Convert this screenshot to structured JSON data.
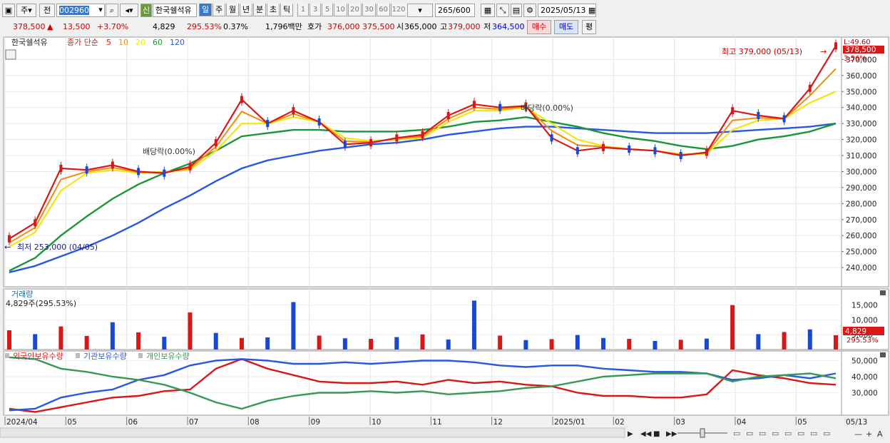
{
  "toolbar": {
    "market": "주",
    "prev": "전",
    "code": "002960",
    "name": "한국쉘석유",
    "new_badge": "신",
    "periods": [
      "일",
      "주",
      "월",
      "년",
      "분",
      "초",
      "틱"
    ],
    "active_period": "일",
    "intervals": [
      "1",
      "3",
      "5",
      "10",
      "20",
      "30",
      "60",
      "120"
    ],
    "count": "265",
    "count_total": "/600",
    "date": "2025/05/13"
  },
  "quote": {
    "price": "378,500",
    "arrow": "▲",
    "change": "13,500",
    "change_pct": "+3.70%",
    "volume": "4,829",
    "volume_ratio": "295.53%",
    "turnover_pct": "0.37%",
    "amount": "1,796백만",
    "ask_label": "호가",
    "ask": "376,000",
    "bid": "375,500",
    "open_label": "시",
    "open": "365,000",
    "high_label": "고",
    "high": "379,000",
    "low_label": "저",
    "low": "364,500",
    "buy_button": "매수",
    "sell_button": "매도",
    "avg_button": "평"
  },
  "colors": {
    "up": "#d81818",
    "down": "#1848d8",
    "ma5": "#d81818",
    "ma10": "#f08c14",
    "ma20": "#f0e614",
    "ma60": "#189638",
    "ma120": "#2858e0",
    "foreign": "#d81818",
    "institution": "#2858e0",
    "individual": "#389858"
  },
  "chart_data": [
    {
      "type": "candlestick",
      "title": "한국쉘석유",
      "legend": {
        "label": "종가 단순",
        "periods": [
          "5",
          "10",
          "20",
          "60",
          "120"
        ]
      },
      "last_label": "378,500",
      "pct_label": "3.56%",
      "top_label": "L:49.60",
      "ylim": [
        228000,
        384000
      ],
      "yticks": [
        240000,
        250000,
        260000,
        270000,
        280000,
        290000,
        300000,
        310000,
        320000,
        330000,
        340000,
        350000,
        360000,
        370000
      ],
      "ytick_labels": [
        "240,000",
        "250,000",
        "260,000",
        "270,000",
        "280,000",
        "290,000",
        "300,000",
        "310,000",
        "320,000",
        "330,000",
        "340,000",
        "350,000",
        "360,000",
        "370,000"
      ],
      "x": [
        "2024-04",
        "2024-05",
        "2024-06",
        "2024-07",
        "2024-08",
        "2024-09",
        "2024-10",
        "2024-11",
        "2024-12",
        "2025-01",
        "2025-02",
        "2025-03",
        "2025-04",
        "2025-05"
      ],
      "close": [
        258000,
        268000,
        302000,
        301000,
        304000,
        300000,
        299000,
        303000,
        318000,
        345000,
        330000,
        338000,
        331000,
        317000,
        318000,
        321000,
        323000,
        335000,
        342000,
        340000,
        341000,
        321000,
        313000,
        315000,
        314000,
        313000,
        310000,
        312000,
        338000,
        335000,
        333000,
        352000,
        378500
      ],
      "ma20": [
        253000,
        262000,
        288000,
        299000,
        301000,
        299000,
        300000,
        301000,
        313000,
        330000,
        330000,
        334000,
        331000,
        321000,
        319000,
        320000,
        321000,
        331000,
        338000,
        338000,
        340000,
        330000,
        320000,
        316000,
        314000,
        313000,
        311000,
        311000,
        326000,
        332000,
        333000,
        343000,
        350000
      ],
      "ma60": [
        238000,
        246000,
        260000,
        272000,
        283000,
        292000,
        299000,
        305000,
        313000,
        322000,
        324000,
        326000,
        326000,
        325000,
        325000,
        325000,
        326000,
        328000,
        331000,
        332000,
        334000,
        331000,
        328000,
        324000,
        321000,
        319000,
        316000,
        314000,
        316000,
        320000,
        322000,
        325000,
        330000
      ],
      "ma120": [
        237000,
        241000,
        247000,
        253000,
        260000,
        268000,
        277000,
        285000,
        294000,
        302000,
        307000,
        310000,
        313000,
        315000,
        317000,
        318000,
        320000,
        323000,
        325000,
        327000,
        328000,
        328000,
        327000,
        326000,
        325000,
        324000,
        324000,
        324000,
        325000,
        326000,
        327000,
        328000,
        330000
      ],
      "annotations": [
        {
          "text": "최고 379,000 (05/13)",
          "date": "2025-05-13",
          "value": 379000
        },
        {
          "text": "최저 253,000 (04/05)",
          "date": "2024-04-05",
          "value": 253000
        },
        {
          "text": "배당락(0.00%)",
          "date": "2024-06-27"
        },
        {
          "text": "배당락(0.00%)",
          "date": "2024-12-27"
        }
      ]
    },
    {
      "type": "bar",
      "title": "거래량",
      "subtitle": "4,829주(295.53%)",
      "last_label": "4,829",
      "pct_label": "295.53%",
      "ylim": [
        0,
        19000
      ],
      "yticks": [
        5000,
        10000,
        15000
      ],
      "ytick_labels": [
        "5,000",
        "10,000",
        "15,000"
      ],
      "values": [
        6500,
        5200,
        7800,
        4600,
        9200,
        5800,
        4300,
        12500,
        5600,
        3900,
        4100,
        16000,
        4700,
        3800,
        3600,
        4200,
        5100,
        3400,
        16500,
        4700,
        3200,
        3500,
        4900,
        3900,
        3600,
        2900,
        3300,
        3700,
        15000,
        5200,
        5900,
        6800,
        4829
      ],
      "up": [
        true,
        false,
        true,
        true,
        false,
        true,
        false,
        true,
        false,
        true,
        false,
        false,
        true,
        false,
        true,
        false,
        true,
        false,
        false,
        true,
        false,
        true,
        false,
        false,
        true,
        false,
        true,
        false,
        true,
        false,
        true,
        false,
        true
      ]
    },
    {
      "type": "line",
      "legend": [
        "외국인보유수량",
        "기관보유수량",
        "개인보유수량"
      ],
      "ylim": [
        16000,
        56000
      ],
      "yticks": [
        30000,
        40000,
        50000
      ],
      "ytick_labels": [
        "30,000",
        "40,000",
        "50,000"
      ],
      "series": [
        {
          "name": "외국인보유수량",
          "values": [
            20000,
            18000,
            21000,
            24000,
            27000,
            28000,
            31000,
            32000,
            45000,
            51000,
            45000,
            41000,
            37000,
            36000,
            36000,
            37000,
            35000,
            38000,
            36000,
            37000,
            35000,
            34000,
            30000,
            28000,
            28000,
            27000,
            27000,
            29000,
            44000,
            41000,
            39000,
            36000,
            35000
          ]
        },
        {
          "name": "기관보유수량",
          "values": [
            19000,
            20000,
            27000,
            30000,
            32000,
            38000,
            41000,
            47000,
            50000,
            51000,
            50000,
            48000,
            48000,
            49000,
            48000,
            49000,
            50000,
            50000,
            49000,
            47000,
            46000,
            47000,
            47000,
            45000,
            44000,
            43000,
            43000,
            42000,
            38000,
            39000,
            41000,
            39000,
            42000
          ]
        },
        {
          "name": "개인보유수량",
          "values": [
            52000,
            51000,
            45000,
            43000,
            40000,
            38000,
            35000,
            30000,
            24000,
            20000,
            25000,
            28000,
            30000,
            30000,
            31000,
            30000,
            31000,
            29000,
            30000,
            31000,
            33000,
            34000,
            37000,
            40000,
            41000,
            42000,
            42000,
            42000,
            37000,
            40000,
            41000,
            42000,
            39000
          ]
        }
      ]
    }
  ],
  "x_axis_labels": [
    "2024/04",
    "05",
    "06",
    "07",
    "08",
    "09",
    "10",
    "11",
    "12",
    "2025/01",
    "02",
    "03",
    "04",
    "05"
  ],
  "right_date": "05/13"
}
